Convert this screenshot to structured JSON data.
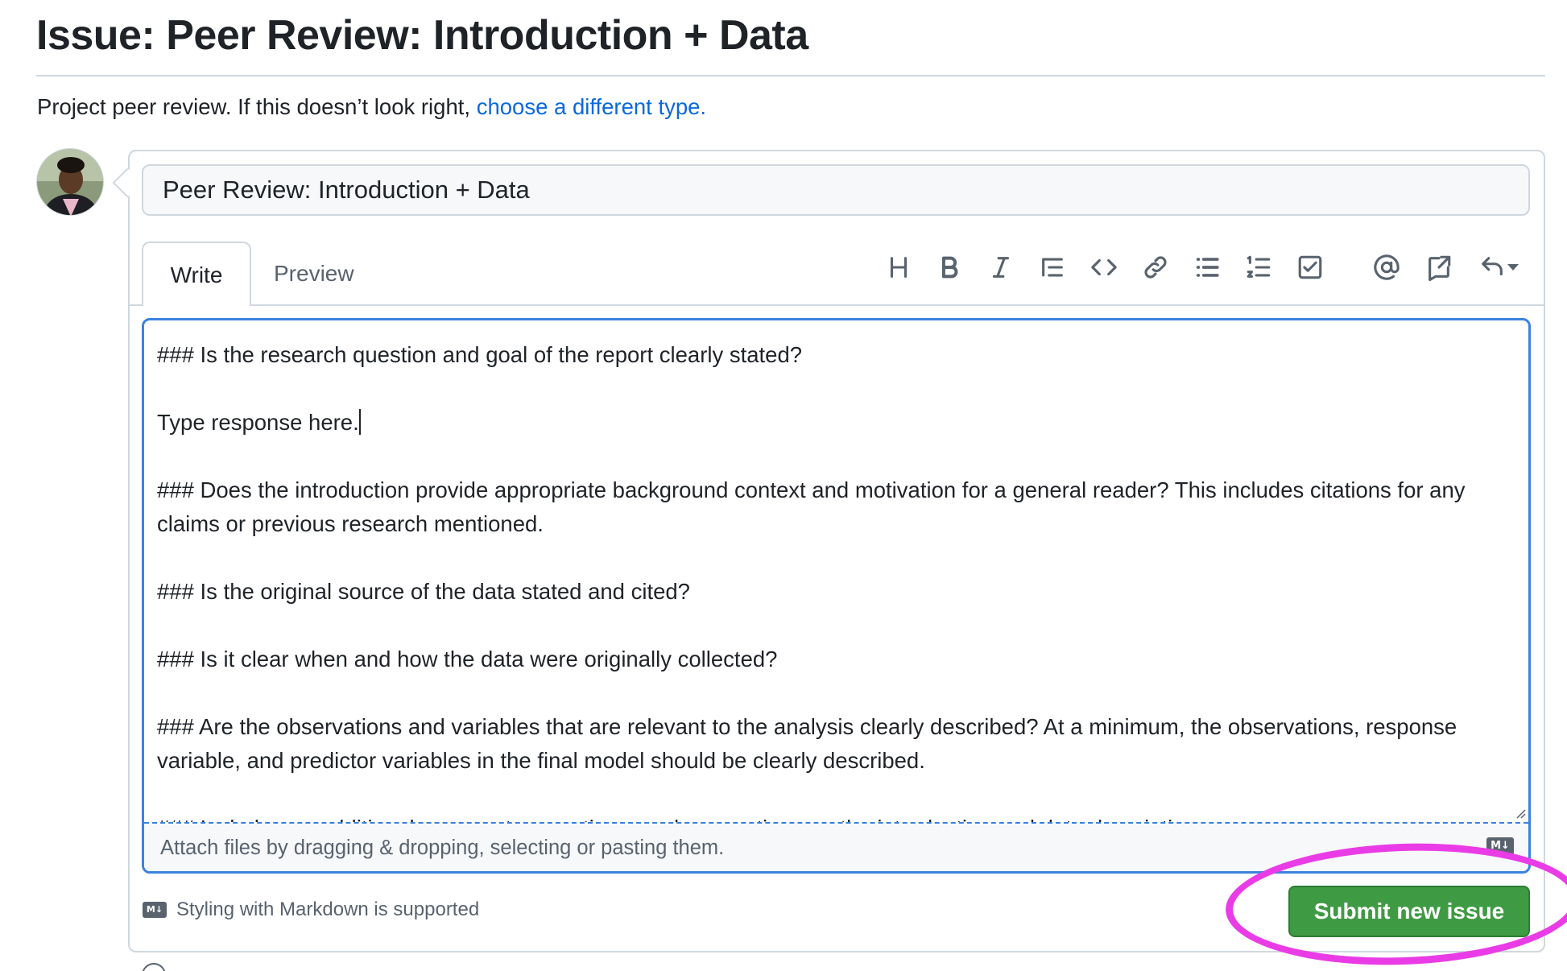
{
  "page": {
    "title": "Issue: Peer Review: Introduction + Data",
    "type_notice": "Project peer review. If this doesn’t look right, ",
    "type_link": "choose a different type."
  },
  "issue_form": {
    "title_value": "Peer Review: Introduction + Data",
    "tabs": [
      {
        "label": "Write",
        "active": true
      },
      {
        "label": "Preview",
        "active": false
      }
    ],
    "toolbar": [
      {
        "icon": "heading-icon"
      },
      {
        "icon": "bold-icon"
      },
      {
        "icon": "italic-icon"
      },
      {
        "icon": "quote-icon"
      },
      {
        "icon": "code-icon"
      },
      {
        "icon": "link-icon"
      },
      {
        "icon": "unordered-list-icon"
      },
      {
        "icon": "ordered-list-icon"
      },
      {
        "icon": "task-list-icon"
      },
      {
        "icon": "mention-icon"
      },
      {
        "icon": "reference-icon"
      },
      {
        "icon": "saved-replies-icon"
      }
    ],
    "body_lines": [
      "### Is the research question and goal of the report clearly stated?",
      "",
      "Type response here.",
      "",
      "### Does the introduction provide appropriate background context and motivation for a general reader? This includes citations for any claims or previous research mentioned.",
      "",
      "### Is the original source of the data stated and cited?",
      "",
      "### Is it clear when and how the data were originally collected?",
      "",
      "### Are the observations and variables that are relevant to the analysis clearly described? At a minimum, the observations, response variable, and predictor variables in the final model should be clearly described.",
      "",
      "### Include any additional comments, questions, and suggestions on the introduction and data description."
    ],
    "attach_hint": "Attach files by dragging & dropping, selecting or pasting them.",
    "markdown_note": "Styling with Markdown is supported",
    "markdown_badge": "M↓",
    "submit_label": "Submit new issue"
  },
  "colors": {
    "link": "#0969da",
    "submit_bg": "#3f9a44",
    "focus_border": "#3b82e0",
    "annotation": "#ea3ce6"
  }
}
